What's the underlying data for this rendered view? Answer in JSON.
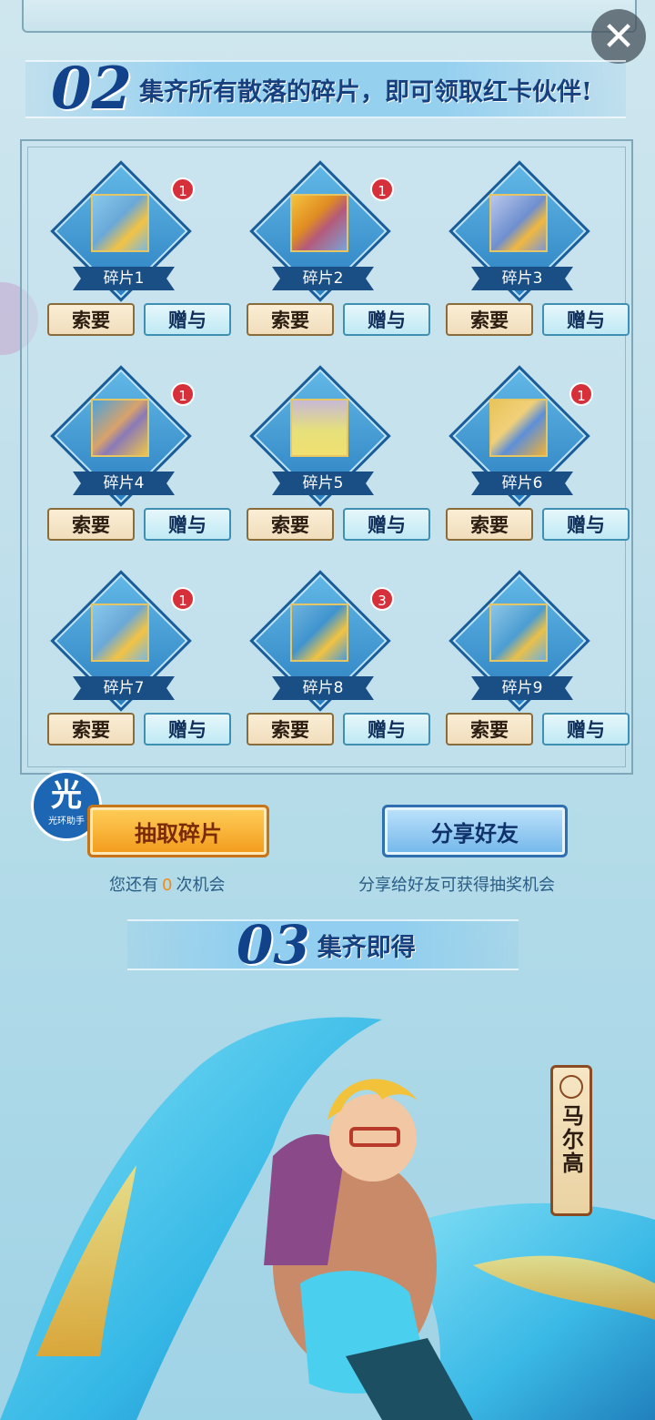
{
  "close_label": "✕",
  "section2": {
    "number": "02",
    "title": "集齐所有散落的碎片，即可领取红卡伙伴!"
  },
  "fragments": [
    {
      "label": "碎片1",
      "badge": "1",
      "ask": "索要",
      "give": "赠与"
    },
    {
      "label": "碎片2",
      "badge": "1",
      "ask": "索要",
      "give": "赠与"
    },
    {
      "label": "碎片3",
      "badge": "",
      "ask": "索要",
      "give": "赠与"
    },
    {
      "label": "碎片4",
      "badge": "1",
      "ask": "索要",
      "give": "赠与"
    },
    {
      "label": "碎片5",
      "badge": "",
      "ask": "索要",
      "give": "赠与"
    },
    {
      "label": "碎片6",
      "badge": "1",
      "ask": "索要",
      "give": "赠与"
    },
    {
      "label": "碎片7",
      "badge": "1",
      "ask": "索要",
      "give": "赠与"
    },
    {
      "label": "碎片8",
      "badge": "3",
      "ask": "索要",
      "give": "赠与"
    },
    {
      "label": "碎片9",
      "badge": "",
      "ask": "索要",
      "give": "赠与"
    }
  ],
  "actions": {
    "draw_label": "抽取碎片",
    "share_label": "分享好友",
    "chance_prefix": "您还有",
    "chance_count": "0",
    "chance_suffix": "次机会",
    "share_hint": "分享给好友可获得抽奖机会"
  },
  "assistant": {
    "glyph": "光",
    "caption": "光环助手"
  },
  "section3": {
    "number": "03",
    "title": "集齐即得"
  },
  "character": {
    "name": "马尔高"
  },
  "colors": {
    "accent_orange": "#f29a1a",
    "accent_blue": "#1a4f86",
    "badge_red": "#d6303a"
  }
}
